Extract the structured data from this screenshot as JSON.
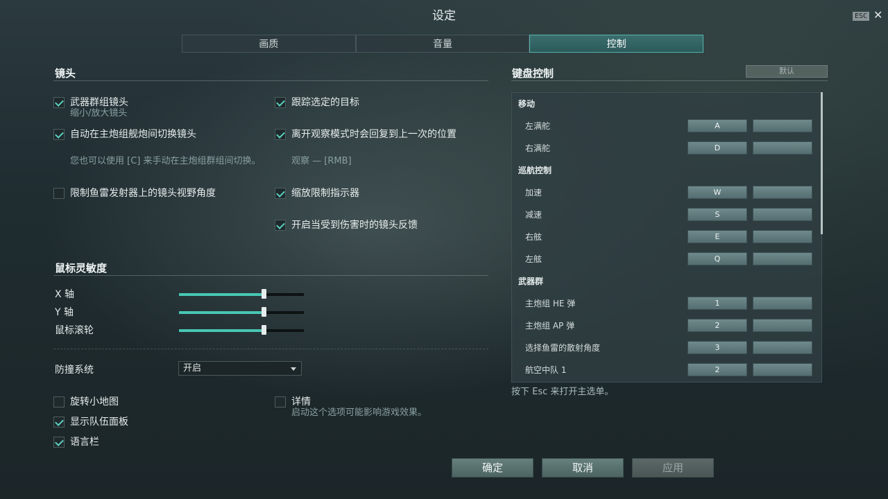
{
  "title": "设定",
  "esc_badge": "ESC",
  "close_glyph": "✕",
  "tabs": [
    {
      "label": "画质",
      "active": false
    },
    {
      "label": "音量",
      "active": false
    },
    {
      "label": "控制",
      "active": true
    }
  ],
  "camera": {
    "header": "镜头",
    "options": [
      {
        "label": "武器群组镜头",
        "checked": true,
        "hint": "缩小/放大镜头"
      },
      {
        "label": "跟踪选定的目标",
        "checked": true
      },
      {
        "label": "自动在主炮组舰炮间切换镜头",
        "checked": true,
        "hint": "您也可以使用 [C] 来手动在主炮组群组间切换。"
      },
      {
        "label": "离开观察模式时会回复到上一次的位置",
        "checked": true,
        "hint": "观察 — [RMB]"
      },
      {
        "label": "限制鱼雷发射器上的镜头视野角度",
        "checked": false
      },
      {
        "label": "缩放限制指示器",
        "checked": true
      },
      {
        "label": "开启当受到伤害时的镜头反馈",
        "checked": true
      }
    ]
  },
  "mouse": {
    "header": "鼠标灵敏度",
    "sliders": [
      {
        "label": "X 轴",
        "value": 0.68
      },
      {
        "label": "Y 轴",
        "value": 0.68
      },
      {
        "label": "鼠标滚轮",
        "value": 0.68
      }
    ]
  },
  "collision": {
    "label": "防撞系统",
    "selected": "开启"
  },
  "misc": [
    {
      "label": "旋转小地图",
      "checked": false
    },
    {
      "label": "详情",
      "checked": false,
      "hint": "启动这个选项可能影响游戏效果。"
    },
    {
      "label": "显示队伍面板",
      "checked": true
    },
    {
      "label": "语言栏",
      "checked": true
    }
  ],
  "keyboard": {
    "header": "键盘控制",
    "default_label": "默认",
    "groups": [
      {
        "name": "移动",
        "items": [
          {
            "name": "左满舵",
            "key1": "A",
            "key2": ""
          },
          {
            "name": "右满舵",
            "key1": "D",
            "key2": ""
          }
        ]
      },
      {
        "name": "巡航控制",
        "items": [
          {
            "name": "加速",
            "key1": "W",
            "key2": ""
          },
          {
            "name": "减速",
            "key1": "S",
            "key2": ""
          },
          {
            "name": "右舷",
            "key1": "E",
            "key2": ""
          },
          {
            "name": "左舷",
            "key1": "Q",
            "key2": ""
          }
        ]
      },
      {
        "name": "武器群",
        "items": [
          {
            "name": "主炮组 HE 弹",
            "key1": "1",
            "key2": ""
          },
          {
            "name": "主炮组 AP 弹",
            "key1": "2",
            "key2": ""
          },
          {
            "name": "选择鱼雷的散射角度",
            "key1": "3",
            "key2": ""
          },
          {
            "name": "航空中队 1",
            "key1": "2",
            "key2": ""
          }
        ]
      }
    ],
    "esc_hint": "按下 Esc 来打开主选单。"
  },
  "footer": {
    "ok": "确定",
    "cancel": "取消",
    "apply": "应用"
  }
}
